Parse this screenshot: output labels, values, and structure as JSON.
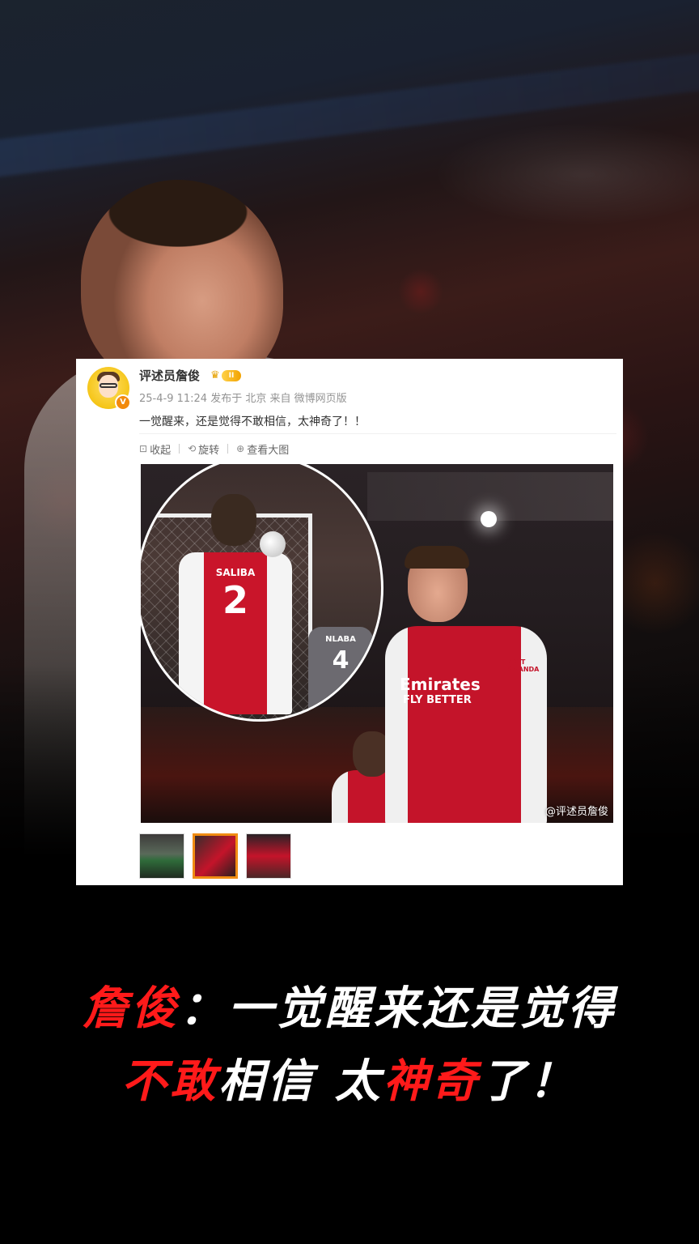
{
  "post": {
    "username": "评述员詹俊",
    "level_badge": "II",
    "verified_badge": "V",
    "meta": "25-4-9 11:24  发布于 北京  来自 微博网页版",
    "text": "一觉醒来，还是觉得不敢相信，太神奇了！！",
    "actions": [
      {
        "label": "收起",
        "icon": "collapse-icon"
      },
      {
        "label": "旋转",
        "icon": "rotate-icon"
      },
      {
        "label": "查看大图",
        "icon": "zoom-icon"
      }
    ],
    "image": {
      "inset_jersey_name": "SALIBA",
      "inset_jersey_number": "2",
      "opponent_name": "NLABA",
      "opponent_number": "4",
      "sponsor_line1": "Emirates",
      "sponsor_line2": "FLY BETTER",
      "sleeve_text": "VISIT RWANDA",
      "watermark": "@评述员詹俊"
    },
    "thumbnails": [
      {
        "name": "thumb-1",
        "selected": false
      },
      {
        "name": "thumb-2",
        "selected": true
      },
      {
        "name": "thumb-3",
        "selected": false
      }
    ]
  },
  "headline": {
    "line1_red": "詹俊",
    "line1_white": "：一觉醒来还是觉得",
    "line2_red1": "不敢",
    "line2_white1": "相信  太",
    "line2_red2": "神奇",
    "line2_white2": "了！"
  },
  "colors": {
    "accent_red": "#ff1a1a",
    "thumb_selected": "#f08c12",
    "badge_gold": "#f2a200"
  }
}
